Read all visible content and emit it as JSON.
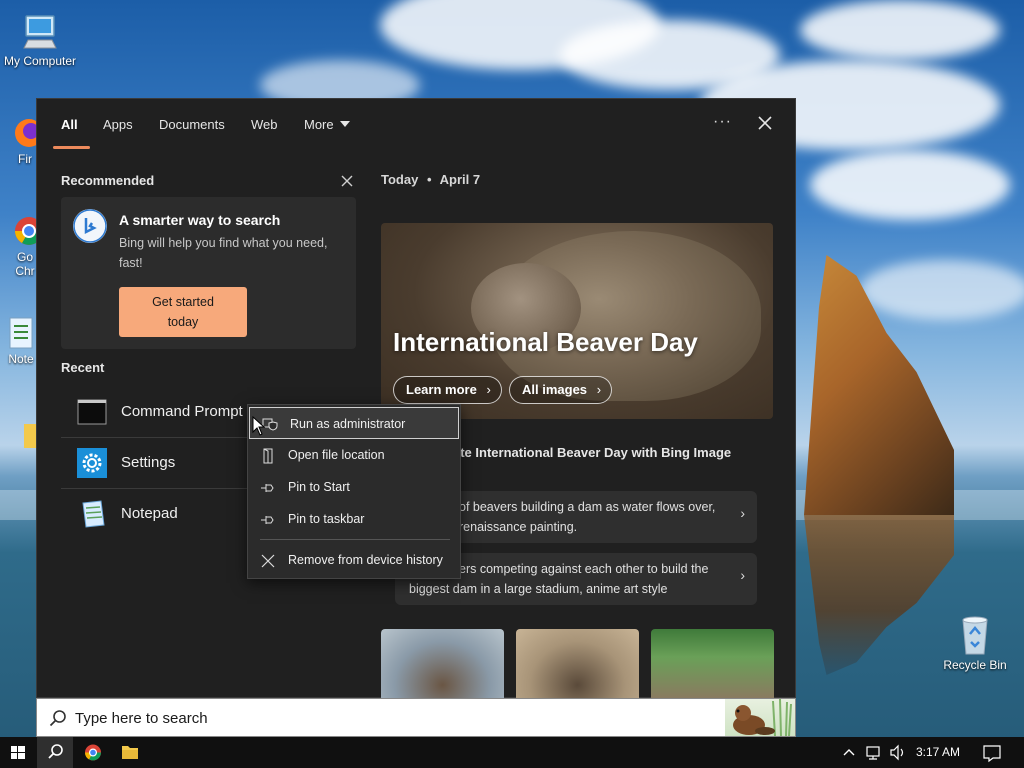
{
  "desktop": {
    "icons": {
      "my_computer": "My Computer",
      "firefox": "Fir",
      "chrome_line1": "Go",
      "chrome_line2": "Chr",
      "notepad": "Note",
      "recycle_bin": "Recycle Bin"
    }
  },
  "search_panel": {
    "tabs": [
      {
        "label": "All",
        "active": true
      },
      {
        "label": "Apps"
      },
      {
        "label": "Documents"
      },
      {
        "label": "Web"
      },
      {
        "label": "More"
      }
    ],
    "more_options_icon": "ellipsis-icon",
    "close_icon": "close-icon",
    "recommended": {
      "heading": "Recommended",
      "card_title": "A smarter way to search",
      "card_desc": "Bing will help you find what you need, fast!",
      "button_line1": "Get started",
      "button_line2": "today"
    },
    "recent": {
      "heading": "Recent",
      "items": [
        {
          "label": "Command Prompt",
          "icon": "command-prompt-icon"
        },
        {
          "label": "Settings",
          "icon": "gear-icon"
        },
        {
          "label": "Notepad",
          "icon": "notepad-icon"
        }
      ]
    },
    "today": {
      "label": "Today",
      "separator": "•",
      "date": "April 7",
      "hero_title": "International Beaver Day",
      "learn_more": "Learn more",
      "all_images": "All images",
      "celebrate_line1": "ate International Beaver Day with Bing Image",
      "celebrate_line2": "r",
      "prompts": [
        {
          "line1": "of beavers building a dam as water flows over,",
          "line2": "renaissance painting."
        },
        {
          "line1": "ers competing against each other to build the",
          "line2": "biggest dam in a large stadium, anime art style"
        }
      ]
    }
  },
  "context_menu": {
    "items": [
      {
        "label": "Run as administrator",
        "icon": "shield-icon",
        "highlighted": true
      },
      {
        "label": "Open file location",
        "icon": "folder-location-icon"
      },
      {
        "label": "Pin to Start",
        "icon": "pin-icon"
      },
      {
        "label": "Pin to taskbar",
        "icon": "pin-icon"
      },
      {
        "label": "Remove from device history",
        "icon": "close-icon"
      }
    ]
  },
  "search_bar": {
    "placeholder": "Type here to search"
  },
  "taskbar": {
    "time": "3:17 AM"
  },
  "colors": {
    "accent": "#ec8a5c",
    "bing_button": "#f7a97b",
    "panel_bg": "#202020"
  }
}
